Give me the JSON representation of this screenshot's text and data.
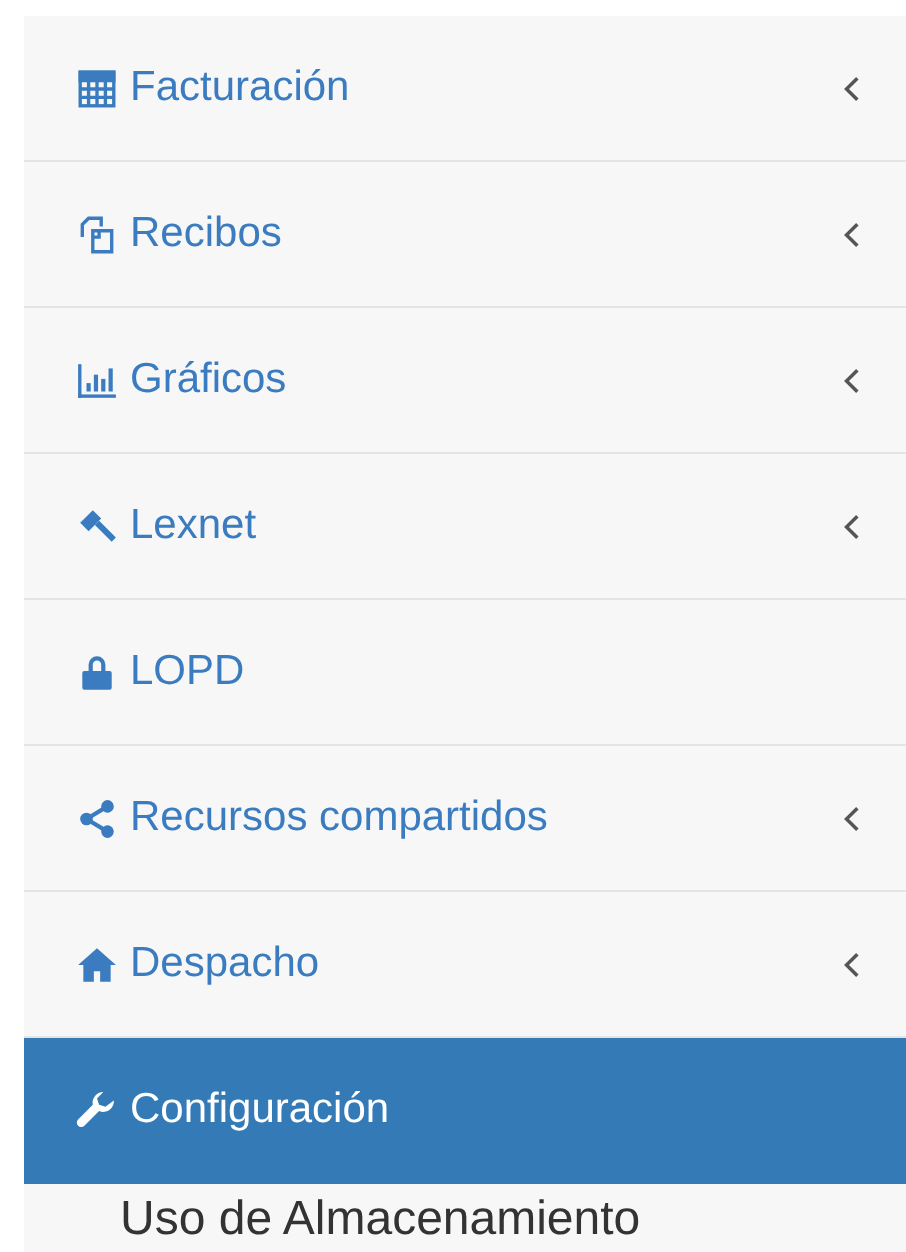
{
  "menu": {
    "items": [
      {
        "label": "Facturación",
        "has_submenu": true,
        "selected": false
      },
      {
        "label": "Recibos",
        "has_submenu": true,
        "selected": false
      },
      {
        "label": "Gráficos",
        "has_submenu": true,
        "selected": false
      },
      {
        "label": "Lexnet",
        "has_submenu": true,
        "selected": false
      },
      {
        "label": "LOPD",
        "has_submenu": false,
        "selected": false
      },
      {
        "label": "Recursos compartidos",
        "has_submenu": true,
        "selected": false
      },
      {
        "label": "Despacho",
        "has_submenu": true,
        "selected": false
      },
      {
        "label": "Configuración",
        "has_submenu": false,
        "selected": true
      }
    ]
  },
  "section_heading": "Uso de Almacenamiento"
}
